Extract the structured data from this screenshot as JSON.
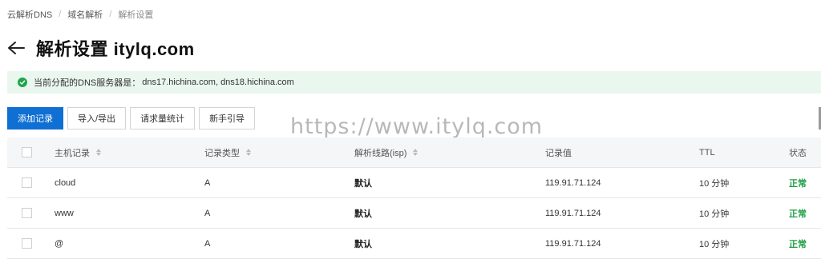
{
  "breadcrumb": {
    "items": [
      "云解析DNS",
      "域名解析",
      "解析设置"
    ],
    "separator": "/"
  },
  "header": {
    "back_icon": "arrow-left-icon",
    "title": "解析设置 itylq.com"
  },
  "notice": {
    "icon": "check-circle-icon",
    "label": "当前分配的DNS服务器是：",
    "value": "dns17.hichina.com, dns18.hichina.com",
    "color": "#1fa54a"
  },
  "toolbar": {
    "add_record": "添加记录",
    "import_export": "导入/导出",
    "request_stats": "请求量统计",
    "guide": "新手引导",
    "primary_color": "#0f6fd3"
  },
  "watermark": "https://www.itylq.com",
  "table": {
    "columns": [
      "主机记录",
      "记录类型",
      "解析线路(isp)",
      "记录值",
      "TTL",
      "状态"
    ],
    "rows": [
      {
        "host": "cloud",
        "type": "A",
        "line": "默认",
        "value": "119.91.71.124",
        "ttl": "10 分钟",
        "status": "正常"
      },
      {
        "host": "www",
        "type": "A",
        "line": "默认",
        "value": "119.91.71.124",
        "ttl": "10 分钟",
        "status": "正常"
      },
      {
        "host": "@",
        "type": "A",
        "line": "默认",
        "value": "119.91.71.124",
        "ttl": "10 分钟",
        "status": "正常"
      }
    ],
    "status_color": "#1f9e45"
  }
}
